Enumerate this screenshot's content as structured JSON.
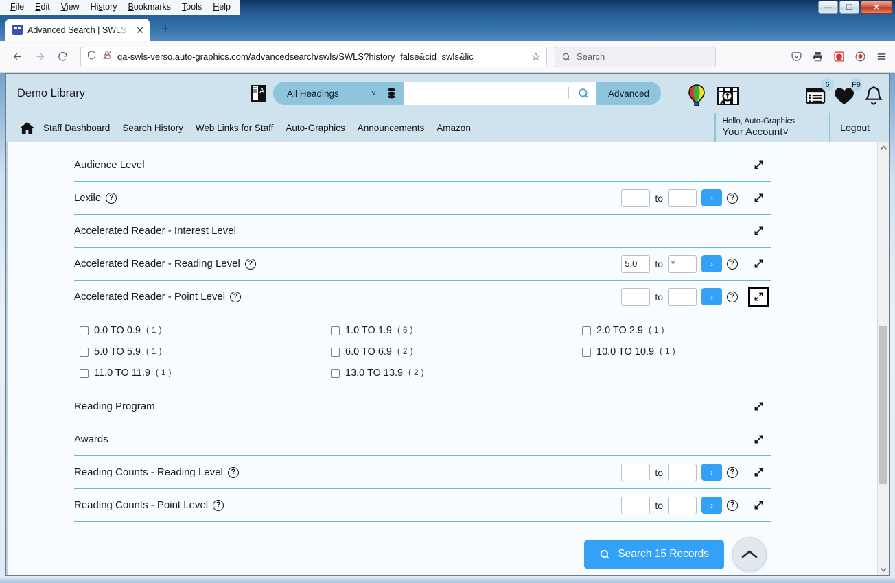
{
  "window": {
    "menu": [
      "File",
      "Edit",
      "View",
      "History",
      "Bookmarks",
      "Tools",
      "Help"
    ],
    "minimize_label": "—",
    "maximize_label": "❑",
    "close_label": "✕"
  },
  "browser": {
    "tab_title": "Advanced Search | SWLS | SWLS",
    "tab_close_label": "✕",
    "new_tab_label": "+",
    "back_label": "←",
    "forward_label": "→",
    "reload_label": "⟳",
    "url": "qa-swls-verso.auto-graphics.com/advancedsearch/swls/SWLS?history=false&cid=swls&lic",
    "bookmark_label": "☆",
    "search_placeholder": "Search",
    "icons": [
      "pocket-icon",
      "print-icon",
      "adblock-icon",
      "shield-icon",
      "menu-icon"
    ]
  },
  "app": {
    "brand": "Demo Library",
    "search": {
      "scope": "All Headings",
      "chevron": "˅",
      "query": "",
      "advanced_label": "Advanced"
    },
    "header_icons": [
      {
        "name": "balloon-icon",
        "badge": ""
      },
      {
        "name": "book-search-icon",
        "badge": ""
      },
      {
        "name": "list-records-icon",
        "badge": "6"
      },
      {
        "name": "favorites-heart-icon",
        "badge": "F9"
      },
      {
        "name": "notifications-bell-icon",
        "badge": ""
      }
    ],
    "nav": [
      "Staff Dashboard",
      "Search History",
      "Web Links for Staff",
      "Auto-Graphics",
      "Announcements",
      "Amazon"
    ],
    "account": {
      "hello": "Hello, Auto-Graphics",
      "your_account": "Your Account",
      "chevron": "˅",
      "logout": "Logout"
    }
  },
  "filters": {
    "to_label": "to",
    "go_label": "›",
    "help_label": "?",
    "rows": [
      {
        "label": "Audience Level",
        "has_range": false,
        "expanded": false,
        "focused": false
      },
      {
        "label": "Lexile",
        "has_help": true,
        "has_range": true,
        "from": "",
        "to": "",
        "expanded": false,
        "focused": false
      },
      {
        "label": "Accelerated Reader - Interest Level",
        "has_range": false,
        "expanded": false,
        "focused": false
      },
      {
        "label": "Accelerated Reader - Reading Level",
        "has_help": true,
        "has_range": true,
        "from": "5.0",
        "to": "*",
        "expanded": false,
        "focused": false
      },
      {
        "label": "Accelerated Reader - Point Level",
        "has_help": true,
        "has_range": true,
        "from": "",
        "to": "",
        "expanded": true,
        "focused": true
      }
    ],
    "point_level_options": [
      {
        "label": "0.0 TO 0.9",
        "count": "( 1 )",
        "checked": false
      },
      {
        "label": "1.0 TO 1.9",
        "count": "( 6 )",
        "checked": false
      },
      {
        "label": "2.0 TO 2.9",
        "count": "( 1 )",
        "checked": false
      },
      {
        "label": "5.0 TO 5.9",
        "count": "( 1 )",
        "checked": false
      },
      {
        "label": "6.0 TO 6.9",
        "count": "( 2 )",
        "checked": false
      },
      {
        "label": "10.0 TO 10.9",
        "count": "( 1 )",
        "checked": false
      },
      {
        "label": "11.0 TO 11.9",
        "count": "( 1 )",
        "checked": false
      },
      {
        "label": "13.0 TO 13.9",
        "count": "( 2 )",
        "checked": false
      }
    ],
    "rows_bottom": [
      {
        "label": "Reading Program",
        "has_range": false,
        "expanded": false
      },
      {
        "label": "Awards",
        "has_range": false,
        "expanded": false
      },
      {
        "label": "Reading Counts - Reading Level",
        "has_help": true,
        "has_range": true,
        "from": "",
        "to": "",
        "expanded": false
      },
      {
        "label": "Reading Counts - Point Level",
        "has_help": true,
        "has_range": true,
        "from": "",
        "to": "",
        "expanded": false
      }
    ]
  },
  "actions": {
    "search_button": "Search 15 Records",
    "scroll_top_label": "⌃"
  },
  "colors": {
    "accent_blue": "#33a1f5",
    "header_bg": "#cfe3ef",
    "scope_bg": "#8fc4dd",
    "divider": "#5bc0de",
    "content_bg": "#f8fcff"
  }
}
